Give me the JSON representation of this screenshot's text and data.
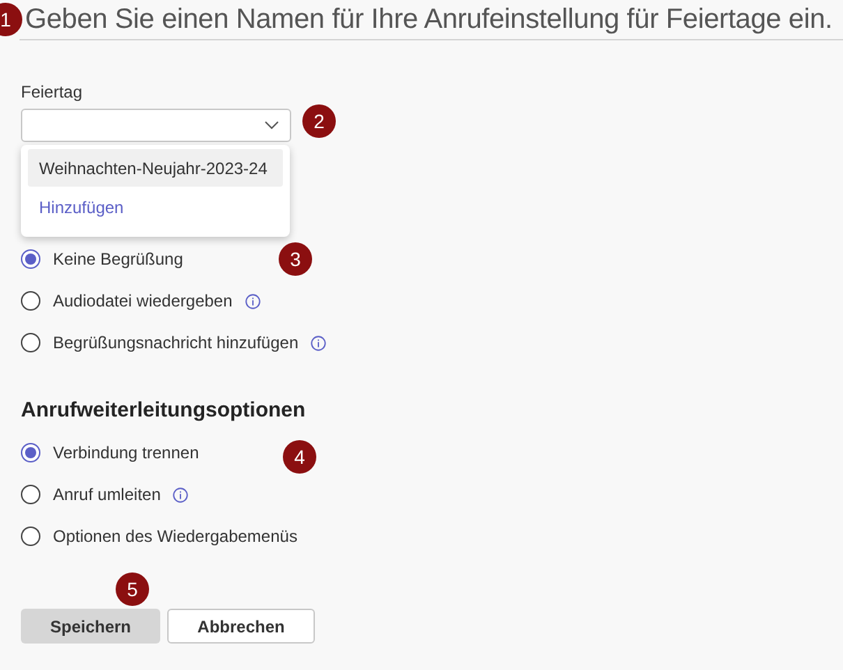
{
  "title": "Geben Sie einen Namen für Ihre Anrufeinstellung für Feiertage ein.",
  "holiday_field": {
    "label": "Feiertag",
    "menu": [
      {
        "kind": "option",
        "label": "Weihnachten-Neujahr-2023-24",
        "selected": true
      },
      {
        "kind": "link",
        "label": "Hinzufügen",
        "selected": false
      }
    ]
  },
  "greeting_options": [
    {
      "label": "Keine Begrüßung",
      "selected": true,
      "info": false
    },
    {
      "label": "Audiodatei wiedergeben",
      "selected": false,
      "info": true
    },
    {
      "label": "Begrüßungsnachricht hinzufügen",
      "selected": false,
      "info": true
    }
  ],
  "forwarding": {
    "heading": "Anrufweiterleitungsoptionen",
    "options": [
      {
        "label": "Verbindung trennen",
        "selected": true,
        "info": false
      },
      {
        "label": "Anruf umleiten",
        "selected": false,
        "info": true
      },
      {
        "label": "Optionen des Wiedergabemenüs",
        "selected": false,
        "info": false
      }
    ]
  },
  "buttons": [
    {
      "label": "Speichern",
      "kind": "primary"
    },
    {
      "label": "Abbrechen",
      "kind": "secondary"
    }
  ],
  "callouts": [
    "1",
    "2",
    "3",
    "4",
    "5"
  ]
}
